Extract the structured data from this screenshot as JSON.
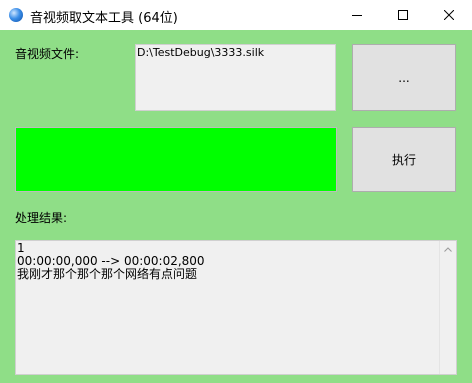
{
  "window": {
    "title": "音视频取文本工具 (64位)",
    "controls": {
      "minimize": "minimize-icon",
      "maximize": "maximize-icon",
      "close": "close-icon"
    }
  },
  "file": {
    "label": "音视频文件:",
    "path": "D:\\TestDebug\\3333.silk",
    "browse_label": "..."
  },
  "progress": {
    "value": 1.0,
    "color": "#00ff00"
  },
  "run_button": {
    "label": "执行"
  },
  "result": {
    "label": "处理结果:",
    "lines": [
      "1",
      "00:00:00,000 --> 00:00:02,800",
      "我刚才那个那个那个网络有点问题"
    ]
  },
  "colors": {
    "background": "#8fde87",
    "titlebar": "#ffffff"
  }
}
